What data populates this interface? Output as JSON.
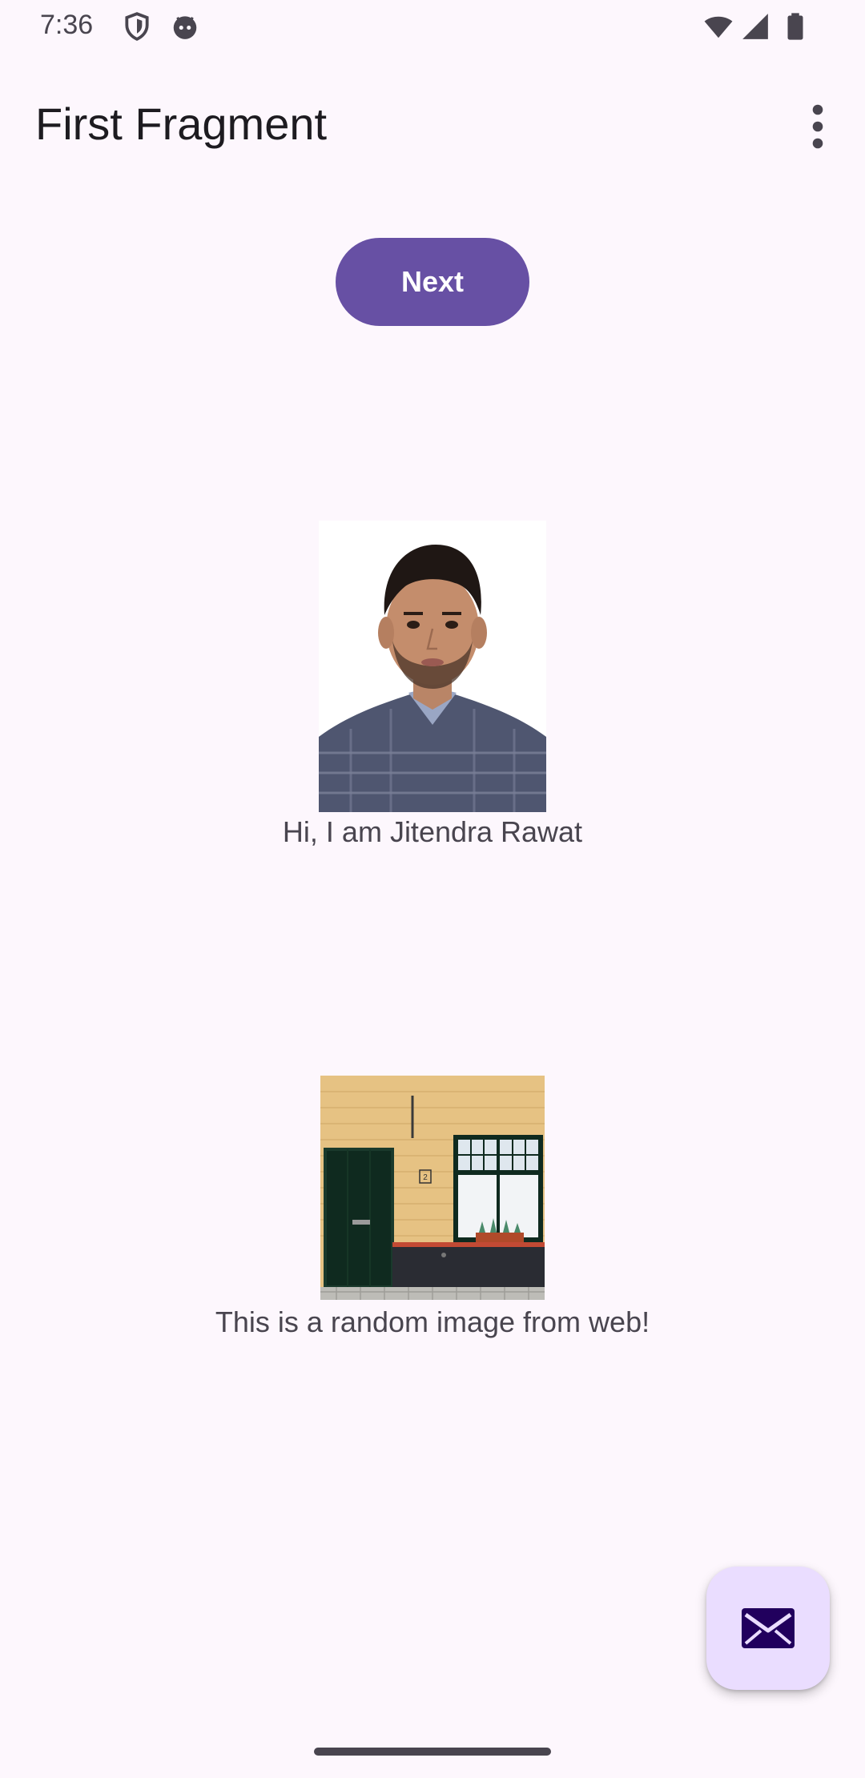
{
  "status_bar": {
    "time": "7:36",
    "icons": [
      "shield-icon",
      "android-icon",
      "wifi-icon",
      "signal-icon",
      "battery-icon"
    ]
  },
  "app_bar": {
    "title": "First Fragment",
    "overflow_icon": "more-vert-icon"
  },
  "main": {
    "next_button_label": "Next",
    "profile": {
      "caption": "Hi, I am Jitendra Rawat"
    },
    "random_image": {
      "caption": "This is a random image from web!"
    }
  },
  "fab": {
    "icon": "email-icon"
  },
  "colors": {
    "background": "#fdf7fd",
    "primary": "#6750a4",
    "fab_container": "#eaddff",
    "on_fab": "#21005d"
  }
}
